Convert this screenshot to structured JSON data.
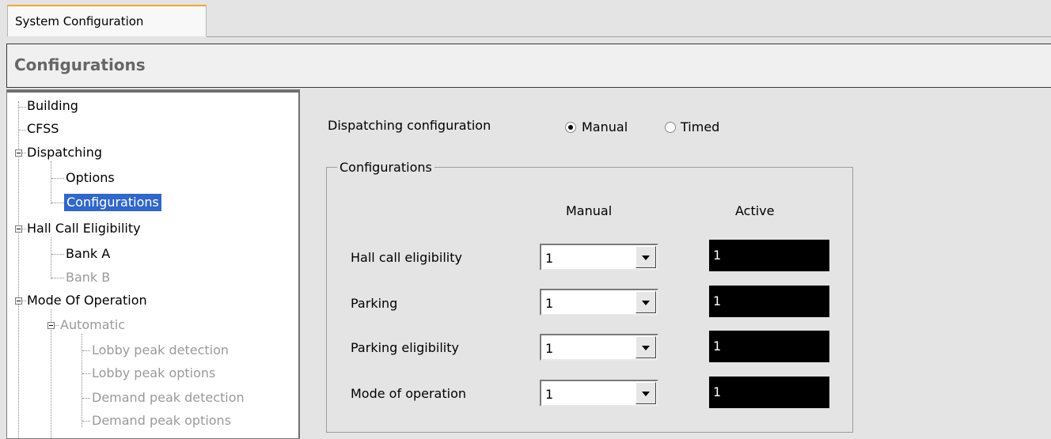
{
  "tab": {
    "label": "System Configuration"
  },
  "header": {
    "title": "Configurations"
  },
  "tree": {
    "building": "Building",
    "cfss": "CFSS",
    "dispatching": "Dispatching",
    "options": "Options",
    "configurations": "Configurations",
    "hall_call": "Hall Call Eligibility",
    "bank_a": "Bank A",
    "bank_b": "Bank B",
    "mode": "Mode Of Operation",
    "automatic": "Automatic",
    "lobby_detect": "Lobby peak detection",
    "lobby_options": "Lobby peak options",
    "demand_detect": "Demand peak detection",
    "demand_options": "Demand peak options"
  },
  "dispatch": {
    "label": "Dispatching configuration",
    "options": [
      {
        "label": "Manual",
        "selected": true
      },
      {
        "label": "Timed",
        "selected": false
      }
    ]
  },
  "group": {
    "title": "Configurations",
    "col_manual": "Manual",
    "col_active": "Active",
    "rows": [
      {
        "label": "Hall call eligibility",
        "manual": "1",
        "active": "1"
      },
      {
        "label": "Parking",
        "manual": "1",
        "active": "1"
      },
      {
        "label": "Parking eligibility",
        "manual": "1",
        "active": "1"
      },
      {
        "label": "Mode of operation",
        "manual": "1",
        "active": "1"
      }
    ]
  }
}
